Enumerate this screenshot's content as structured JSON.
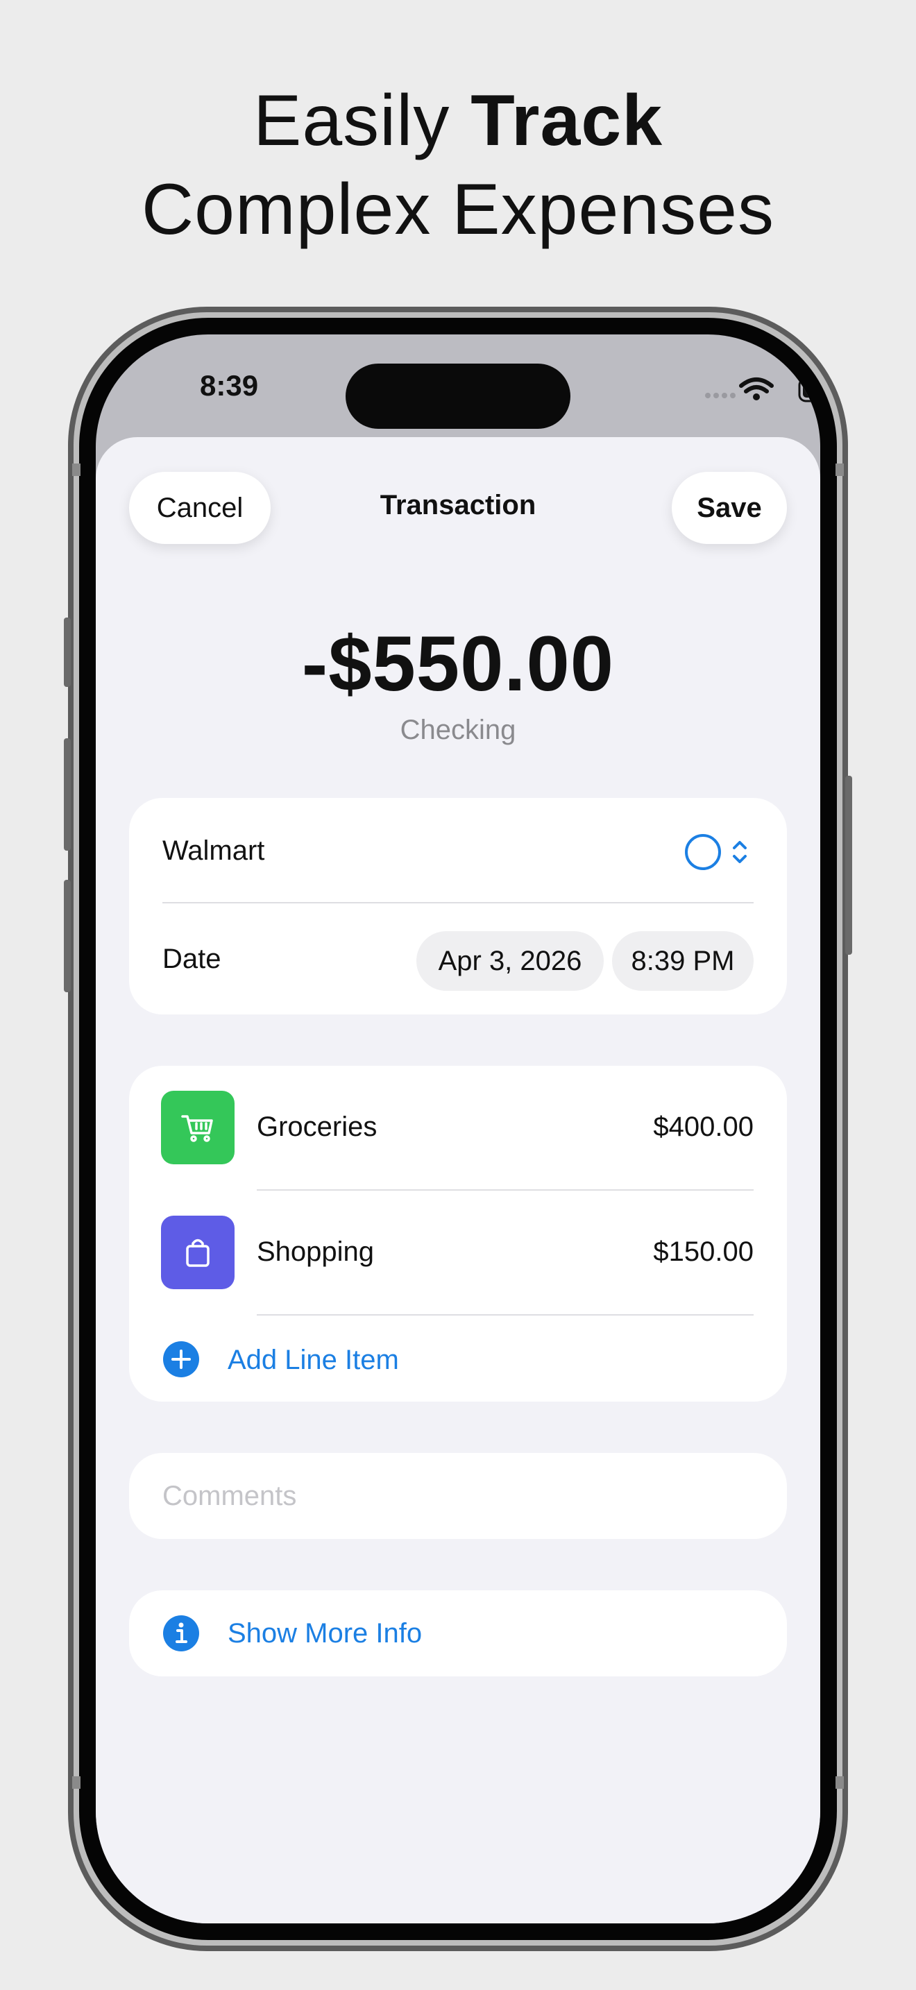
{
  "headline": {
    "line1_regular": "Easily ",
    "line1_bold": "Track",
    "line2": "Complex Expenses"
  },
  "status_bar": {
    "time": "8:39"
  },
  "nav": {
    "cancel_label": "Cancel",
    "title": "Transaction",
    "save_label": "Save"
  },
  "summary": {
    "amount": "-$550.00",
    "account": "Checking"
  },
  "details": {
    "payee": "Walmart",
    "date_label": "Date",
    "date_value": "Apr 3, 2026",
    "time_value": "8:39 PM"
  },
  "line_items": [
    {
      "category": "Groceries",
      "amount": "$400.00",
      "icon": "cart-icon",
      "color": "#34c759"
    },
    {
      "category": "Shopping",
      "amount": "$150.00",
      "icon": "bag-icon",
      "color": "#5e5ce6"
    }
  ],
  "add_line_item_label": "Add Line Item",
  "comments": {
    "placeholder": "Comments"
  },
  "show_more_label": "Show More Info",
  "colors": {
    "accent": "#1b7fe3",
    "background": "#f2f2f7"
  }
}
